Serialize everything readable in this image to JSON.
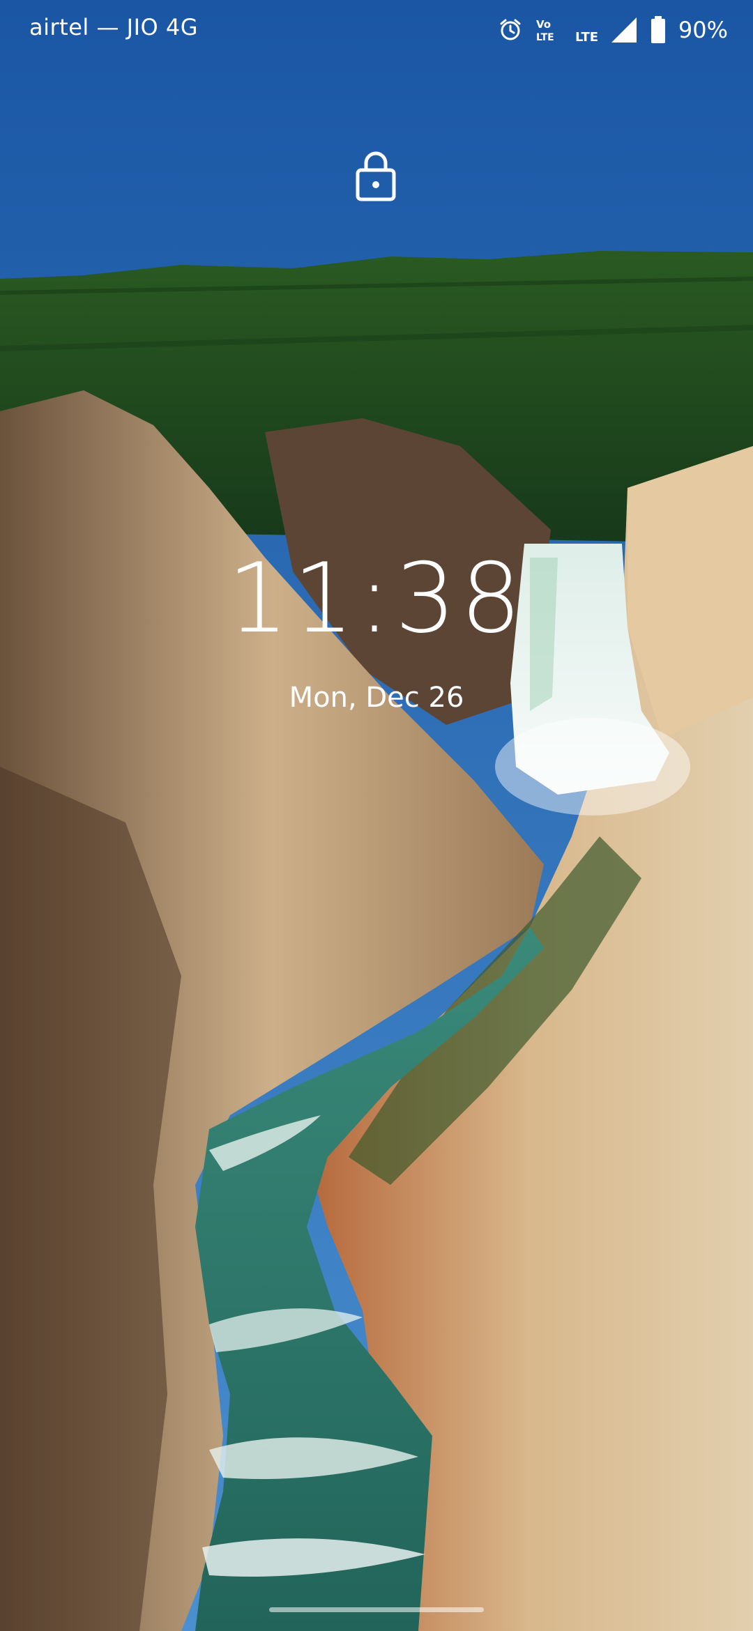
{
  "status_bar": {
    "carrier": "airtel — JIO 4G",
    "icons": [
      "alarm-icon",
      "volte-icon",
      "lte-icon",
      "signal-icon",
      "battery-icon"
    ],
    "volte_label_top": "Vo",
    "volte_label_bottom": "LTE",
    "lte_label": "LTE",
    "battery": "90%"
  },
  "lock_screen": {
    "time": "11:38",
    "date": "Mon, Dec 26",
    "lock_icon": "padlock-icon"
  },
  "wallpaper": {
    "scene": "waterfall-canyon",
    "colors": {
      "sky_top": "#1c5aa8",
      "sky_bottom": "#3f86c9",
      "forest": "#1f4a1c",
      "rock_light": "#d9c3a0",
      "rock_dark": "#7a5f45",
      "river": "#2f7a6a",
      "foam": "#e6f1ee"
    }
  }
}
